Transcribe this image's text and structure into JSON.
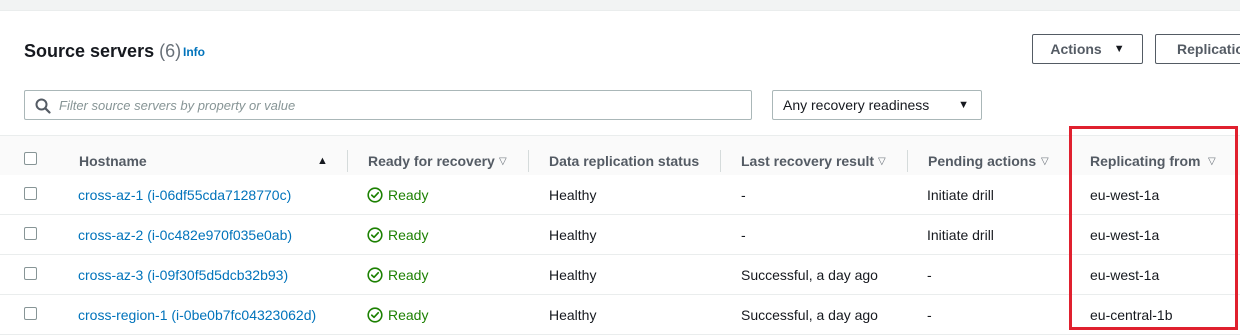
{
  "header": {
    "title": "Source servers",
    "count": "(6)",
    "info_label": "Info",
    "actions_label": "Actions",
    "replication_label": "Replication"
  },
  "filter": {
    "placeholder": "Filter source servers by property or value",
    "readiness_select": "Any recovery readiness"
  },
  "table": {
    "columns": {
      "hostname": "Hostname",
      "ready": "Ready for recovery",
      "data_replication": "Data replication status",
      "last_recovery": "Last recovery result",
      "pending": "Pending actions",
      "replicating_from": "Replicating from"
    },
    "rows": [
      {
        "hostname": "cross-az-1 (i-06df55cda7128770c)",
        "ready": "Ready",
        "data_replication": "Healthy",
        "last_recovery": "-",
        "pending": "Initiate drill",
        "replicating_from": "eu-west-1a"
      },
      {
        "hostname": "cross-az-2 (i-0c482e970f035e0ab)",
        "ready": "Ready",
        "data_replication": "Healthy",
        "last_recovery": "-",
        "pending": "Initiate drill",
        "replicating_from": "eu-west-1a"
      },
      {
        "hostname": "cross-az-3 (i-09f30f5d5dcb32b93)",
        "ready": "Ready",
        "data_replication": "Healthy",
        "last_recovery": "Successful, a day ago",
        "pending": "-",
        "replicating_from": "eu-west-1a"
      },
      {
        "hostname": "cross-region-1 (i-0be0b7fc04323062d)",
        "ready": "Ready",
        "data_replication": "Healthy",
        "last_recovery": "Successful, a day ago",
        "pending": "-",
        "replicating_from": "eu-central-1b"
      }
    ]
  },
  "colors": {
    "link": "#0073bb",
    "success": "#1d8102",
    "highlight": "#e0202e"
  }
}
